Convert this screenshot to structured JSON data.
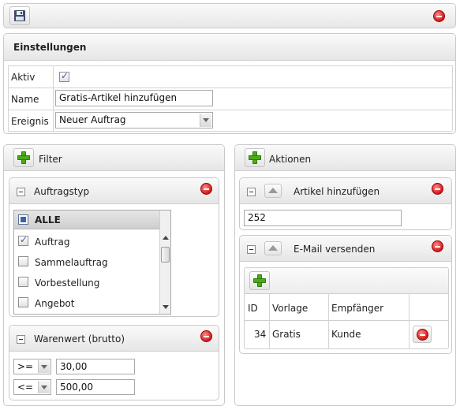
{
  "toolbar": {
    "save_icon": "floppy-disk-icon",
    "close_icon": "delete-icon"
  },
  "settings": {
    "title": "Einstellungen",
    "rows": {
      "aktiv_label": "Aktiv",
      "aktiv_checked": true,
      "name_label": "Name",
      "name_value": "Gratis-Artikel hinzufügen",
      "ereignis_label": "Ereignis",
      "ereignis_value": "Neuer Auftrag"
    }
  },
  "filter": {
    "add_label": "Filter",
    "auftragstyp": {
      "title": "Auftragstyp",
      "items": [
        {
          "label": "ALLE",
          "checked": false,
          "selected": true
        },
        {
          "label": "Auftrag",
          "checked": true,
          "selected": false
        },
        {
          "label": "Sammelauftrag",
          "checked": false,
          "selected": false
        },
        {
          "label": "Vorbestellung",
          "checked": false,
          "selected": false
        },
        {
          "label": "Angebot",
          "checked": false,
          "selected": false
        }
      ]
    },
    "warenwert": {
      "title": "Warenwert (brutto)",
      "rows": [
        {
          "operator": ">=",
          "value": "30,00"
        },
        {
          "operator": "<=",
          "value": "500,00"
        }
      ]
    }
  },
  "actions": {
    "add_label": "Aktionen",
    "artikel": {
      "title": "Artikel hinzufügen",
      "value": "252"
    },
    "email": {
      "title": "E-Mail versenden",
      "table": {
        "headers": [
          "ID",
          "Vorlage",
          "Empfänger"
        ],
        "rows": [
          {
            "id": "34",
            "vorlage": "Gratis",
            "empfaenger": "Kunde"
          }
        ]
      }
    }
  },
  "colors": {
    "delete": "#d11818",
    "add": "#4caa1a",
    "selection": "#d7d7d7"
  }
}
